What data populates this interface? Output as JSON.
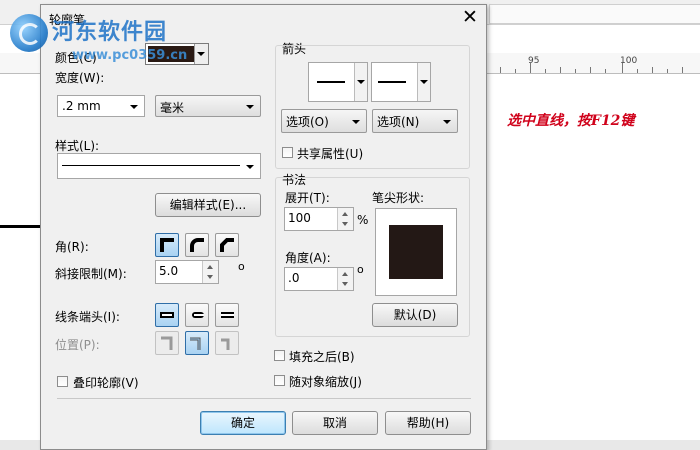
{
  "background": {
    "ruler_labels": [
      "95",
      "100"
    ],
    "annotation": "选中直线，按F12键"
  },
  "watermark": {
    "title": "河东软件园",
    "url": "www.pc0359.cn"
  },
  "dialog": {
    "title": "轮廓笔",
    "close_icon": "close-x",
    "color": {
      "label": "颜色(C)",
      "swatch": "#2a1a14"
    },
    "width": {
      "label": "宽度(W):",
      "value": ".2 mm",
      "unit": "毫米"
    },
    "style": {
      "label": "样式(L):",
      "edit_button": "编辑样式(E)..."
    },
    "corners": {
      "label": "角(R):",
      "selected_index": 0
    },
    "miter": {
      "label": "斜接限制(M):",
      "value": "5.0",
      "unit": "o"
    },
    "line_caps": {
      "label": "线条端头(I):",
      "selected_index": 0
    },
    "position": {
      "label": "位置(P):",
      "selected_index": 1
    },
    "overprint": {
      "label": "叠印轮廓(V)",
      "checked": false
    },
    "arrows": {
      "label": "箭头",
      "options_left": "选项(O)",
      "options_right": "选项(N)",
      "share": {
        "label": "共享属性(U)",
        "checked": false
      }
    },
    "calligraphy": {
      "label": "书法",
      "stretch": {
        "label": "展开(T):",
        "value": "100",
        "unit": "%"
      },
      "angle": {
        "label": "角度(A):",
        "value": ".0",
        "unit": "o"
      },
      "nib_label": "笔尖形状:",
      "nib_color": "#231815",
      "default_button": "默认(D)"
    },
    "behind_fill": {
      "label": "填充之后(B)",
      "checked": false
    },
    "scale_with_object": {
      "label": "随对象缩放(J)",
      "checked": false
    },
    "buttons": {
      "ok": "确定",
      "cancel": "取消",
      "help": "帮助(H)"
    }
  }
}
